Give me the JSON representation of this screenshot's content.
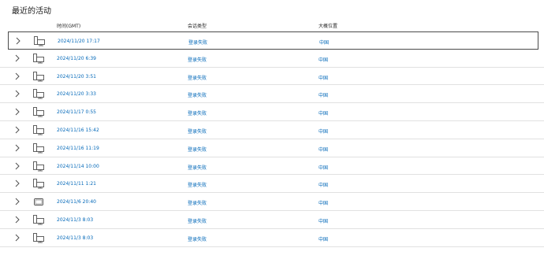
{
  "title": "最近的活动",
  "columns": {
    "time": "时间(GMT)",
    "type": "会话类型",
    "location": "大概位置"
  },
  "rows": [
    {
      "time": "2024/11/20 17:17",
      "type": "登录失败",
      "location": "中国",
      "device": "computer",
      "selected": true
    },
    {
      "time": "2024/11/20 6:39",
      "type": "登录失败",
      "location": "中国",
      "device": "computer"
    },
    {
      "time": "2024/11/20 3:51",
      "type": "登录失败",
      "location": "中国",
      "device": "computer"
    },
    {
      "time": "2024/11/20 3:33",
      "type": "登录失败",
      "location": "中国",
      "device": "computer"
    },
    {
      "time": "2024/11/17 0:55",
      "type": "登录失败",
      "location": "中国",
      "device": "computer"
    },
    {
      "time": "2024/11/16 15:42",
      "type": "登录失败",
      "location": "中国",
      "device": "computer"
    },
    {
      "time": "2024/11/16 11:19",
      "type": "登录失败",
      "location": "中国",
      "device": "computer"
    },
    {
      "time": "2024/11/14 10:00",
      "type": "登录失败",
      "location": "中国",
      "device": "computer"
    },
    {
      "time": "2024/11/11 1:21",
      "type": "登录失败",
      "location": "中国",
      "device": "computer"
    },
    {
      "time": "2024/11/6 20:40",
      "type": "登录失败",
      "location": "中国",
      "device": "tablet"
    },
    {
      "time": "2024/11/3 8:03",
      "type": "登录失败",
      "location": "中国",
      "device": "computer"
    },
    {
      "time": "2024/11/3 8:03",
      "type": "登录失败",
      "location": "中国",
      "device": "computer"
    }
  ],
  "colors": {
    "link": "#0067b8",
    "divider": "#e1e1e1",
    "selected_border": "#4a4a4a"
  }
}
